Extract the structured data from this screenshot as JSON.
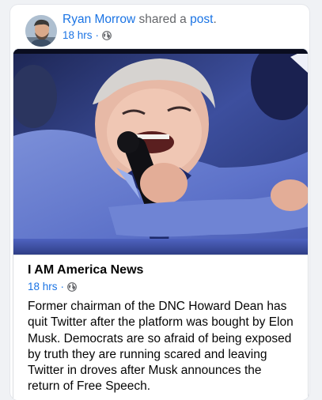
{
  "post": {
    "author": "Ryan Morrow",
    "shared_text": "shared a",
    "post_link": "post",
    "post_period": ".",
    "timestamp": "18 hrs",
    "separator": "·",
    "privacy_icon": "globe-icon"
  },
  "shared_post": {
    "page_name": "I AM America News",
    "timestamp": "18 hrs",
    "separator": "·",
    "privacy_icon": "globe-icon",
    "body": "Former chairman of the DNC Howard Dean has quit Twitter after the platform was bought by Elon Musk. Democrats are so afraid of being exposed by truth they are running scared and leaving Twitter in droves after Musk announces the return of Free Speech."
  },
  "colors": {
    "link_blue": "#1b74e4",
    "secondary_text": "#65676b",
    "primary_text": "#050505",
    "card_bg": "#ffffff",
    "page_bg": "#f0f2f5"
  }
}
